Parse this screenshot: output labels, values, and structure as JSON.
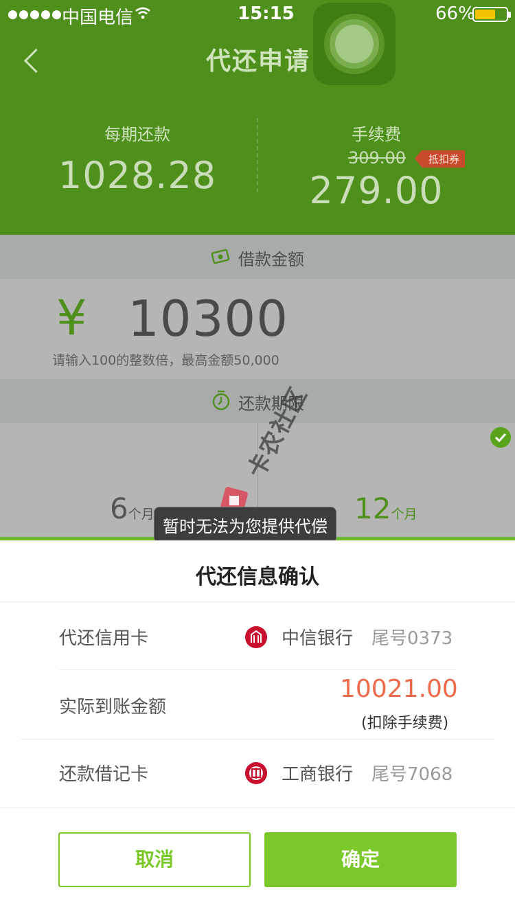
{
  "status_bar": {
    "carrier": "中国电信",
    "time": "15:15",
    "battery_percent": "66%",
    "battery_level": 0.66,
    "signal_icon": "signal-dots-icon",
    "wifi_icon": "wifi-icon"
  },
  "nav": {
    "title": "代还申请",
    "back_icon": "chevron-left-icon"
  },
  "summary": {
    "per_period_label": "每期还款",
    "per_period_value": "1028.28",
    "fee_label": "手续费",
    "fee_original": "309.00",
    "coupon_label": "抵扣券",
    "fee_value": "279.00"
  },
  "loan": {
    "header_label": "借款金额",
    "header_icon": "money-icon",
    "currency_symbol": "¥",
    "amount": "10300",
    "hint": "请输入100的整数倍，最高金额50,000"
  },
  "term": {
    "header_label": "还款期限",
    "header_icon": "clock-icon",
    "options": [
      {
        "number": "6",
        "unit": "个月",
        "selected": false
      },
      {
        "number": "12",
        "unit": "个月",
        "selected": true
      }
    ]
  },
  "watermark": {
    "text": "卡农社区"
  },
  "toast": {
    "message": "暂时无法为您提供代偿"
  },
  "sheet": {
    "title": "代还信息确认",
    "rows": [
      {
        "label": "代还信用卡",
        "bank": "中信银行",
        "tail": "尾号0373",
        "logo_icon": "citic-bank-logo-icon"
      },
      {
        "label": "实际到账金额",
        "amount": "10021.00",
        "note": "(扣除手续费)"
      },
      {
        "label": "还款借记卡",
        "bank": "工商银行",
        "tail": "尾号7068",
        "logo_icon": "icbc-bank-logo-icon"
      }
    ],
    "cancel_label": "取消",
    "confirm_label": "确定"
  },
  "colors": {
    "brand_green": "#7ac82a",
    "header_green": "#4f8f1c",
    "amount_orange": "#ee6a4a",
    "bank_red": "#c8102e"
  }
}
